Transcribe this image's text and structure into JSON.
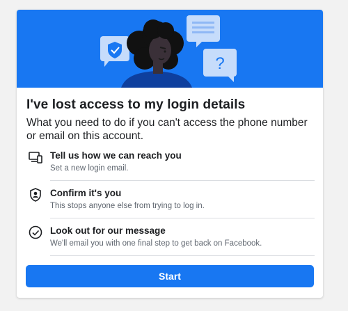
{
  "header": {
    "title": "I've lost access to my login details",
    "subtitle": "What you need to do if you can't access the phone number or email on this account."
  },
  "illustration": {
    "background_color": "#1877f2",
    "question_mark": "?"
  },
  "steps": [
    {
      "icon": "devices-icon",
      "title": "Tell us how we can reach you",
      "description": "Set a new login email."
    },
    {
      "icon": "shield-person-icon",
      "title": "Confirm it's you",
      "description": "This stops anyone else from trying to log in."
    },
    {
      "icon": "check-circle-icon",
      "title": "Look out for our message",
      "description": "We'll email you with one final step to get back on Facebook."
    }
  ],
  "actions": {
    "start_label": "Start",
    "accent_color": "#1877f2"
  }
}
